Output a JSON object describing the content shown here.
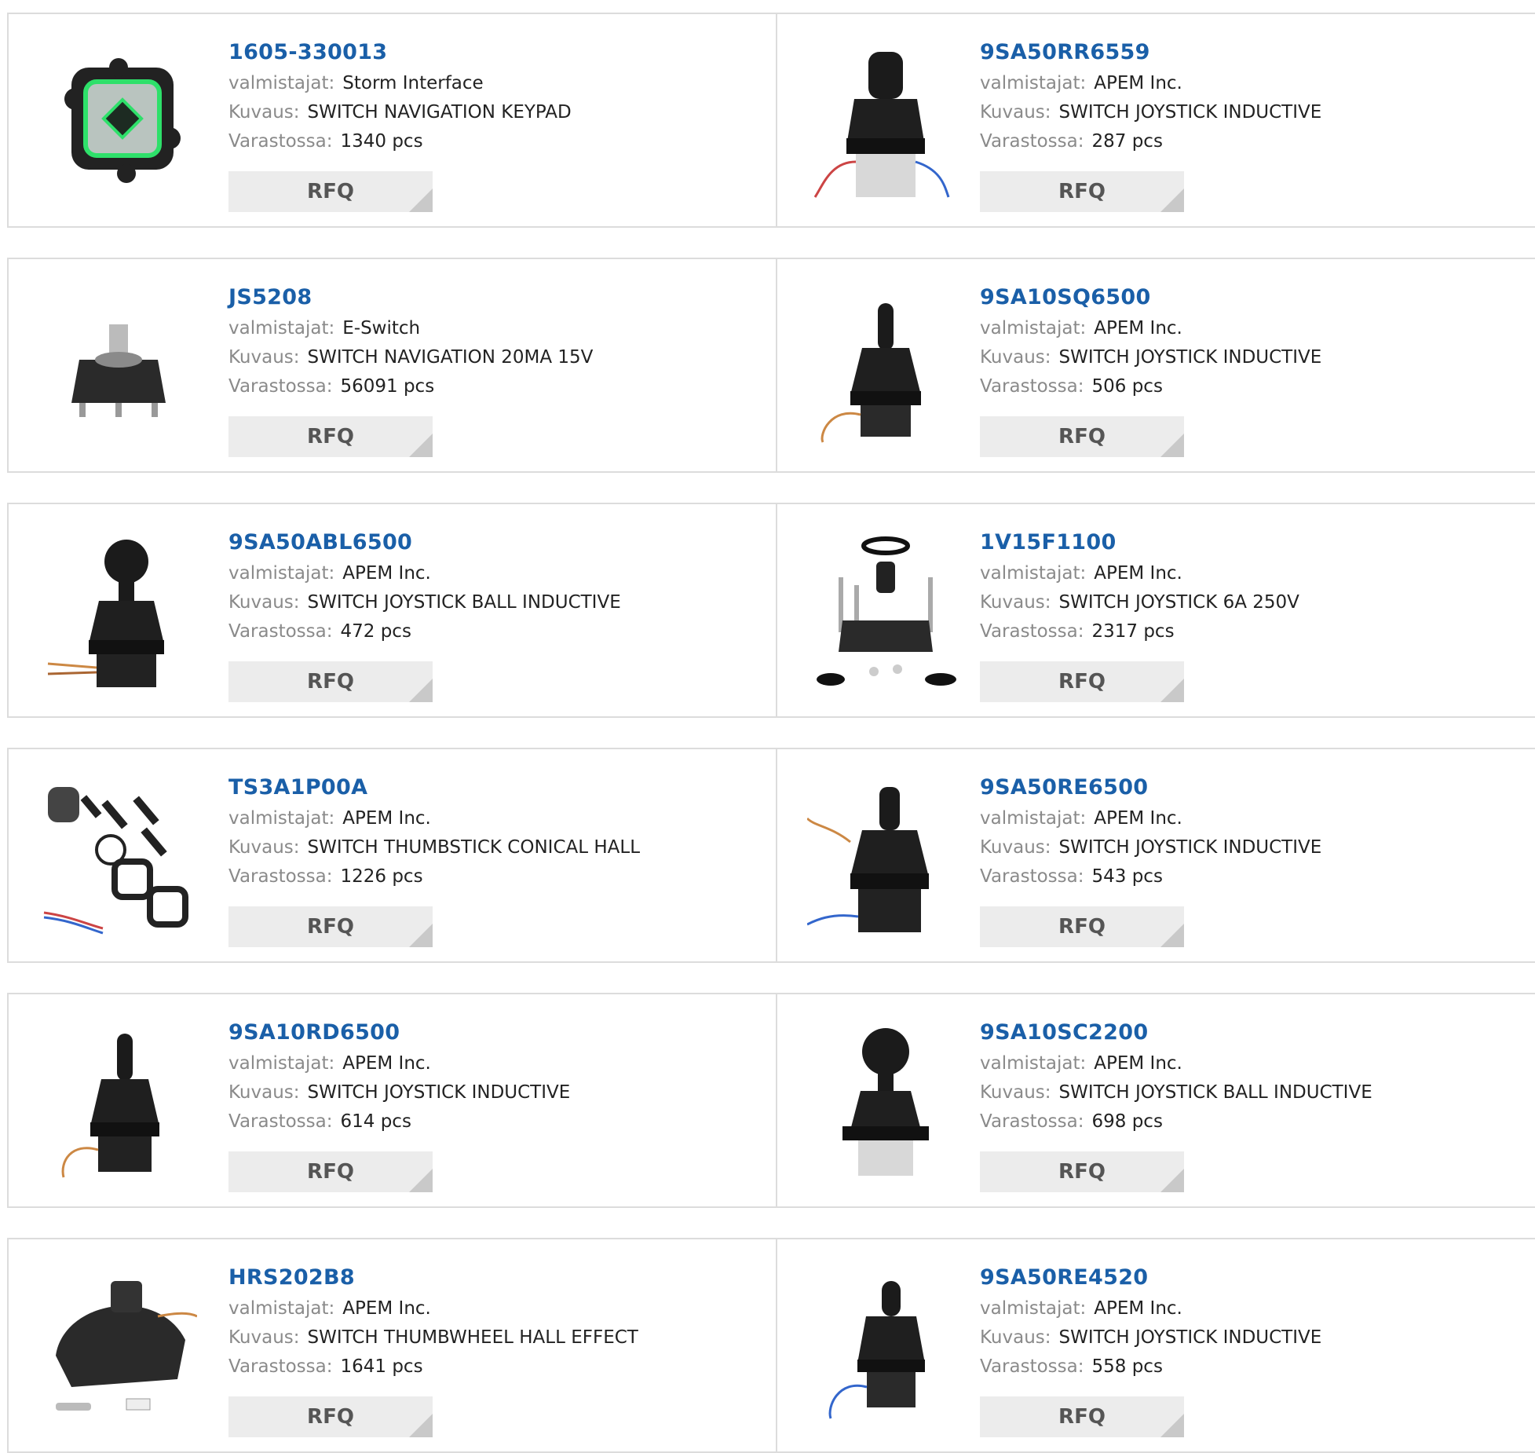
{
  "labels": {
    "manufacturer": "valmistajat:",
    "description": "Kuvaus:",
    "stock": "Varastossa:",
    "rfq": "RFQ"
  },
  "products": [
    {
      "part": "1605-330013",
      "manufacturer": "Storm Interface",
      "description": "SWITCH NAVIGATION KEYPAD",
      "stock": "1340 pcs",
      "icon": "navigation-keypad-icon"
    },
    {
      "part": "9SA50RR6559",
      "manufacturer": "APEM Inc.",
      "description": "SWITCH JOYSTICK INDUCTIVE",
      "stock": "287 pcs",
      "icon": "joystick-icon"
    },
    {
      "part": "JS5208",
      "manufacturer": "E-Switch",
      "description": "SWITCH NAVIGATION 20MA 15V",
      "stock": "56091 pcs",
      "icon": "navigation-switch-icon"
    },
    {
      "part": "9SA10SQ6500",
      "manufacturer": "APEM Inc.",
      "description": "SWITCH JOYSTICK INDUCTIVE",
      "stock": "506 pcs",
      "icon": "joystick-icon"
    },
    {
      "part": "9SA50ABL6500",
      "manufacturer": "APEM Inc.",
      "description": "SWITCH JOYSTICK BALL INDUCTIVE",
      "stock": "472 pcs",
      "icon": "ball-joystick-icon"
    },
    {
      "part": "1V15F1100",
      "manufacturer": "APEM Inc.",
      "description": "SWITCH JOYSTICK 6A 250V",
      "stock": "2317 pcs",
      "icon": "joystick-kit-icon"
    },
    {
      "part": "TS3A1P00A",
      "manufacturer": "APEM Inc.",
      "description": "SWITCH THUMBSTICK CONICAL HALL",
      "stock": "1226 pcs",
      "icon": "thumbstick-kit-icon"
    },
    {
      "part": "9SA50RE6500",
      "manufacturer": "APEM Inc.",
      "description": "SWITCH JOYSTICK INDUCTIVE",
      "stock": "543 pcs",
      "icon": "joystick-icon"
    },
    {
      "part": "9SA10RD6500",
      "manufacturer": "APEM Inc.",
      "description": "SWITCH JOYSTICK INDUCTIVE",
      "stock": "614 pcs",
      "icon": "joystick-icon"
    },
    {
      "part": "9SA10SC2200",
      "manufacturer": "APEM Inc.",
      "description": "SWITCH JOYSTICK BALL INDUCTIVE",
      "stock": "698 pcs",
      "icon": "ball-joystick-icon"
    },
    {
      "part": "HRS202B8",
      "manufacturer": "APEM Inc.",
      "description": "SWITCH THUMBWHEEL HALL EFFECT",
      "stock": "1641 pcs",
      "icon": "thumbwheel-icon"
    },
    {
      "part": "9SA50RE4520",
      "manufacturer": "APEM Inc.",
      "description": "SWITCH JOYSTICK INDUCTIVE",
      "stock": "558 pcs",
      "icon": "joystick-icon"
    }
  ]
}
